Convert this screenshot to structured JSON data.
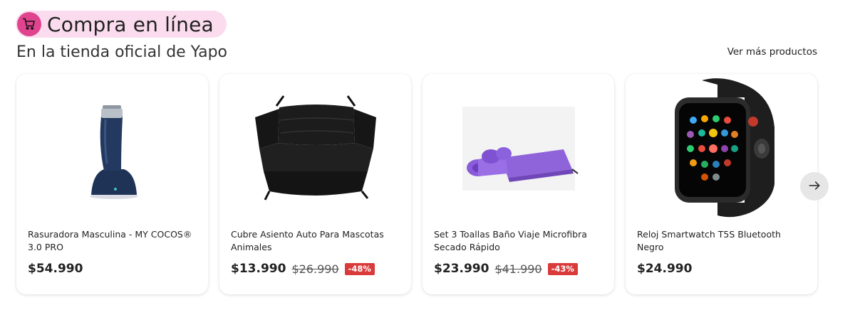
{
  "section": {
    "title": "Compra en línea",
    "badge_icon": "shopping-cart-icon",
    "subtitle": "En la tienda oficial de Yapo",
    "see_more_label": "Ver más productos",
    "accent_color": "#e0448e",
    "badge_bg_color": "#fbdcee"
  },
  "products": [
    {
      "name": "Rasuradora Masculina - MY COCOS® 3.0 PRO",
      "price": "$54.990",
      "old_price": "",
      "discount": "",
      "image": "trimmer-image"
    },
    {
      "name": "Cubre Asiento Auto Para Mascotas Animales",
      "price": "$13.990",
      "old_price": "$26.990",
      "discount": "-48%",
      "image": "car-seat-cover-image"
    },
    {
      "name": "Set 3 Toallas Baño Viaje Microfibra Secado Rápido",
      "price": "$23.990",
      "old_price": "$41.990",
      "discount": "-43%",
      "image": "towels-image"
    },
    {
      "name": "Reloj Smartwatch T5S Bluetooth Negro",
      "price": "$24.990",
      "old_price": "",
      "discount": "",
      "image": "smartwatch-image"
    }
  ],
  "carousel": {
    "next_icon": "arrow-right-icon"
  },
  "colors": {
    "discount_badge": "#d93a3a"
  }
}
